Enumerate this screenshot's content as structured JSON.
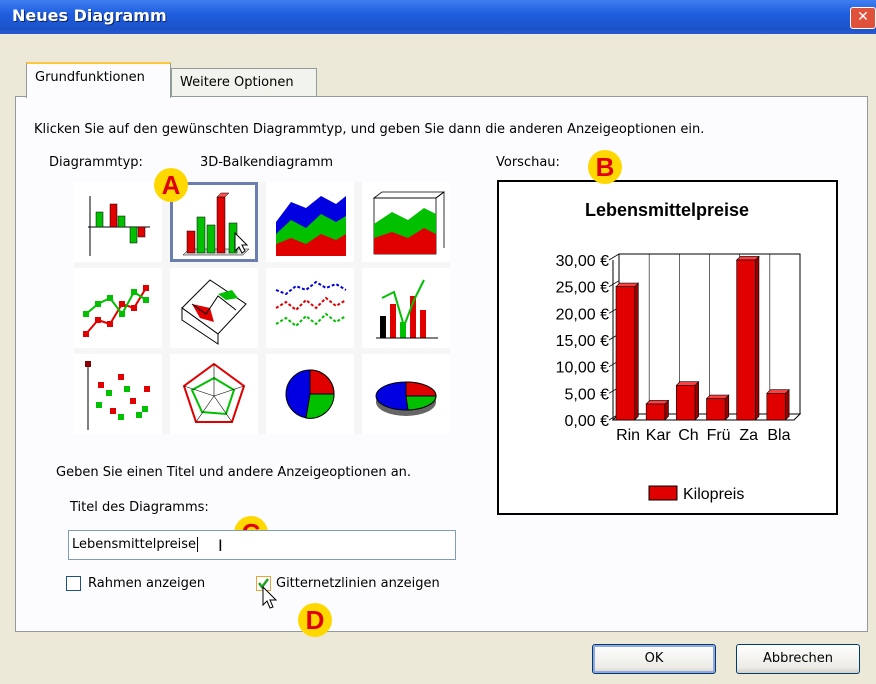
{
  "window": {
    "title": "Neues Diagramm",
    "close_label": "✕"
  },
  "tabs": [
    {
      "label": "Grundfunktionen",
      "active": true
    },
    {
      "label": "Weitere Optionen",
      "active": false
    }
  ],
  "instructions": "Klicken Sie auf den gewünschten Diagrammtyp, und geben Sie dann die anderen Anzeigeoptionen ein.",
  "chart_type": {
    "label": "Diagrammtyp:",
    "selected": "3D-Balkendiagramm"
  },
  "preview_label": "Vorschau:",
  "chart_type_icons": [
    "bar-chart-icon",
    "3d-bar-chart-icon",
    "area-chart-icon",
    "3d-area-chart-icon",
    "line-chart-icon",
    "3d-line-chart-icon",
    "step-line-chart-icon",
    "combo-chart-icon",
    "scatter-chart-icon",
    "radar-chart-icon",
    "pie-chart-icon",
    "3d-pie-chart-icon"
  ],
  "options_hint": "Geben Sie einen Titel und andere Anzeigeoptionen an.",
  "title_field": {
    "label": "Titel des Diagramms:",
    "value": "Lebensmittelpreise"
  },
  "checkboxes": {
    "frame": {
      "label": "Rahmen anzeigen",
      "checked": false
    },
    "grid": {
      "label": "Gitternetzlinien anzeigen",
      "checked": true
    }
  },
  "callouts": {
    "a": "A",
    "b": "B",
    "c": "C",
    "d": "D"
  },
  "buttons": {
    "ok": "OK",
    "cancel": "Abbrechen"
  },
  "colors": {
    "accent": "#e00000",
    "green": "#00c000",
    "blue": "#0000e0",
    "selection": "#6b7fae"
  },
  "chart_data": {
    "type": "bar",
    "title": "Lebensmittelpreise",
    "categories": [
      "Rin",
      "Kar",
      "Ch",
      "Frü",
      "Za",
      "Bla"
    ],
    "series": [
      {
        "name": "Kilopreis",
        "values": [
          25,
          3,
          6.5,
          4,
          30,
          5
        ]
      }
    ],
    "ylim": [
      0,
      30
    ],
    "yticks": [
      "0,00 €",
      "5,00 €",
      "10,00 €",
      "15,00 €",
      "20,00 €",
      "25,00 €",
      "30,00 €"
    ],
    "grid": true,
    "legend": "bottom"
  }
}
